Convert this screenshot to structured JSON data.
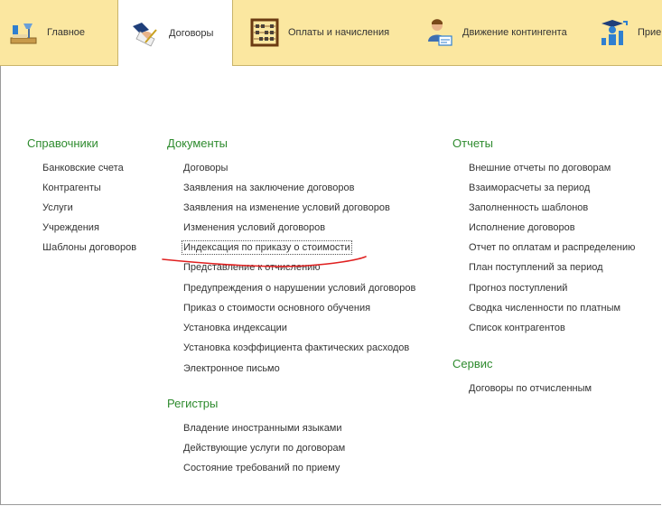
{
  "tabs": [
    {
      "label": "Главное",
      "icon": "desk-lamp-icon"
    },
    {
      "label": "Договоры",
      "icon": "handshake-contract-icon",
      "active": true
    },
    {
      "label": "Оплаты и начисления",
      "icon": "abacus-icon"
    },
    {
      "label": "Движение контингента",
      "icon": "person-card-icon"
    },
    {
      "label": "Прие",
      "icon": "graduate-chart-icon"
    }
  ],
  "sections": {
    "references": {
      "title": "Справочники",
      "items": [
        "Банковские счета",
        "Контрагенты",
        "Услуги",
        "Учреждения",
        "Шаблоны договоров"
      ]
    },
    "documents": {
      "title": "Документы",
      "items": [
        "Договоры",
        "Заявления на заключение договоров",
        "Заявления на изменение условий договоров",
        "Изменения условий договоров",
        "Индексация по приказу о стоимости",
        "Представление к отчислению",
        "Предупреждения о нарушении условий договоров",
        "Приказ о стоимости основного обучения",
        "Установка индексации",
        "Установка коэффициента фактических расходов",
        "Электронное письмо"
      ]
    },
    "registers": {
      "title": "Регистры",
      "items": [
        "Владение иностранными языками",
        "Действующие услуги по договорам",
        "Состояние требований по приему"
      ]
    },
    "reports": {
      "title": "Отчеты",
      "items": [
        "Внешние отчеты по договорам",
        "Взаиморасчеты за период",
        "Заполненность шаблонов",
        "Исполнение договоров",
        "Отчет по оплатам и распределению",
        "План поступлений за период",
        "Прогноз поступлений",
        "Сводка численности по платным",
        "Список контрагентов"
      ]
    },
    "service": {
      "title": "Сервис",
      "items": [
        "Договоры по отчисленным"
      ]
    }
  },
  "colors": {
    "topbar": "#fbe7a0",
    "section_title": "#2e8b2e",
    "annotation_underline": "#e02020"
  }
}
